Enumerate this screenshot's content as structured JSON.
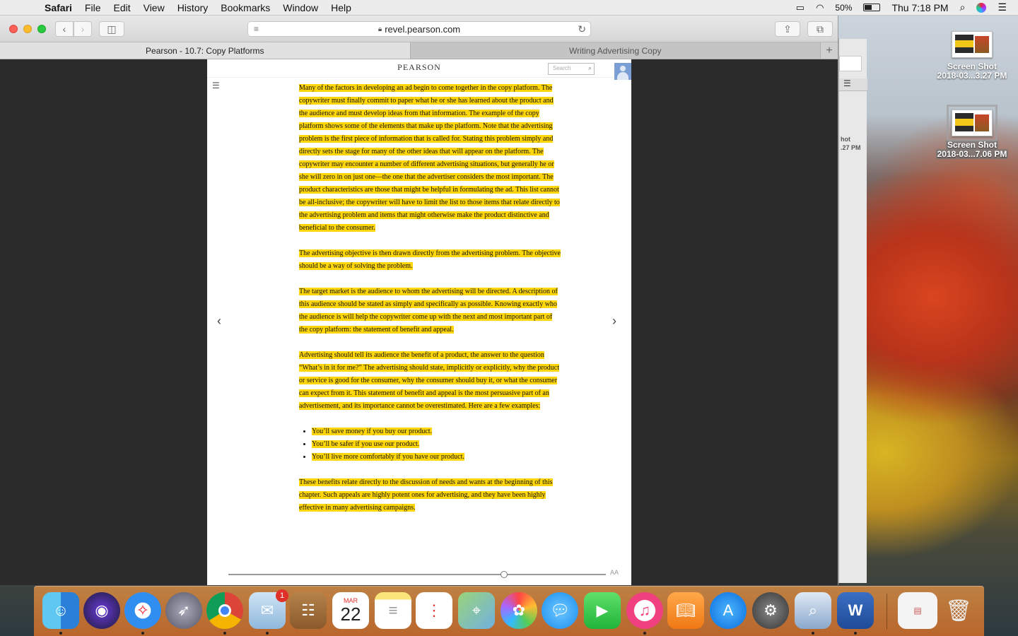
{
  "menubar": {
    "app_name": "Safari",
    "menus": [
      "File",
      "Edit",
      "View",
      "History",
      "Bookmarks",
      "Window",
      "Help"
    ],
    "battery": "50%",
    "clock": "Thu 7:18 PM"
  },
  "browser": {
    "url": "revel.pearson.com",
    "tabs": [
      {
        "label": "Pearson - 10.7: Copy Platforms"
      },
      {
        "label": "Writing Advertising Copy"
      }
    ]
  },
  "page": {
    "brand": "PEARSON",
    "search_placeholder": "Search",
    "paragraphs": [
      "Many of the factors in developing an ad begin to come together in the copy platform. The copywriter must finally commit to paper what he or she has learned about the product and the audience and must develop ideas from that information. The example of the copy platform shows some of the elements that make up the platform. Note that the advertising problem is the first piece of information that is called for. Stating this problem simply and directly sets the stage for many of the other ideas that will appear on the platform. The copywriter may encounter a number of different advertising situations, but generally he or she will zero in on just one—the one that the advertiser considers the most important. The product characteristics are those that might be helpful in formulating the ad. This list cannot be all-inclusive; the copywriter will have to limit the list to those items that relate directly to the advertising problem and items that might otherwise make the product distinctive and beneficial to the consumer.",
      "The advertising objective is then drawn directly from the advertising problem. The objective should be a way of solving the problem.",
      "The target market is the audience to whom the advertising will be directed. A description of this audience should be stated as simply and specifically as possible. Knowing exactly who the audience is will help the copywriter come up with the next and most important part of the copy platform: the statement of benefit and appeal.",
      "Advertising should tell its audience the benefit of a product, the answer to the question “What’s in it for me?” The advertising should state, implicitly or explicitly, why the product or service is good for the consumer, why the consumer should buy it, or what the consumer can expect from it. This statement of benefit and appeal is the most persuasive part of an advertisement, and its importance cannot be overestimated. Here are a few examples:"
    ],
    "bullets": [
      "You’ll save money if you buy our product.",
      "You’ll be safer if you use our product.",
      "You’ll live more comfortably if you have our product."
    ],
    "closing": "These benefits relate directly to the discussion of needs and wants at the beginning of this chapter. Such appeals are highly potent ones for advertising, and they have been highly effective in many advertising campaigns.",
    "font_size_label": "AA",
    "reading_progress": 0.73
  },
  "desktop": {
    "icons": [
      {
        "line1": "Screen Shot",
        "line2": "2018-03...3.27 PM"
      },
      {
        "line1": "Screen Shot",
        "line2": "2018-03...7.06 PM"
      }
    ],
    "bg_window_peek": [
      "hot",
      ".27 PM"
    ]
  },
  "dock": {
    "mail_badge": "1",
    "calendar_month": "MAR",
    "calendar_day": "22"
  },
  "colors": {
    "highlight": "#ffd60a",
    "dock": "#e08a3c"
  }
}
